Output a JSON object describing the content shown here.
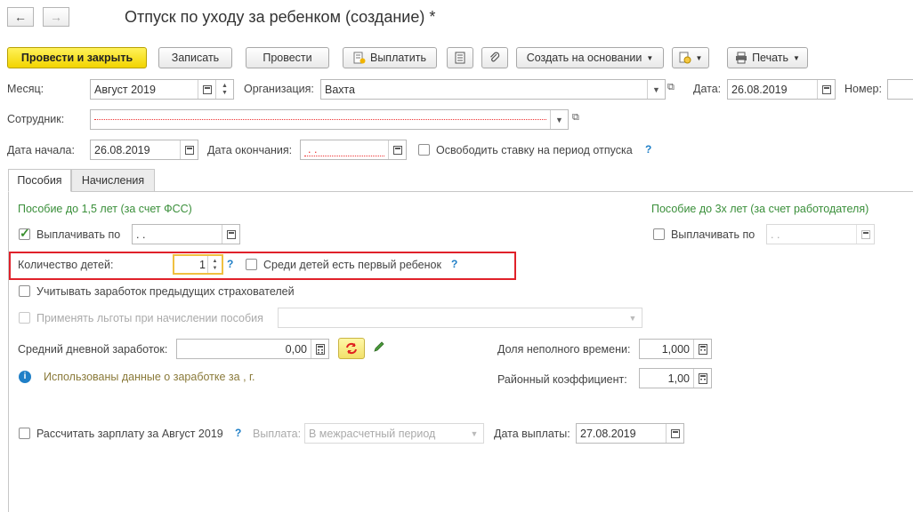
{
  "window": {
    "title": "Отпуск по уходу за ребенком (создание) *"
  },
  "nav": {
    "back_icon": "←",
    "forward_icon": "→"
  },
  "toolbar": {
    "post_close": "Провести и закрыть",
    "save": "Записать",
    "post": "Провести",
    "pay": "Выплатить",
    "create_based": "Создать на основании",
    "print": "Печать"
  },
  "row1": {
    "month_label": "Месяц:",
    "month_value": "Август 2019",
    "org_label": "Организация:",
    "org_value": "Вахта",
    "date_label": "Дата:",
    "date_value": "26.08.2019",
    "number_label": "Номер:"
  },
  "row2": {
    "employee_label": "Сотрудник:",
    "employee_value": ""
  },
  "row3": {
    "start_label": "Дата начала:",
    "start_value": "26.08.2019",
    "end_label": "Дата окончания:",
    "end_value": " .  .",
    "free_rate_label": "Освободить ставку на период отпуска"
  },
  "tabs": [
    {
      "label": "Пособия"
    },
    {
      "label": "Начисления"
    }
  ],
  "benefits": {
    "fss_heading": "Пособие до 1,5 лет (за счет ФСС)",
    "employer_heading": "Пособие до 3х лет (за счет работодателя)",
    "pay_until_label": "Выплачивать по",
    "pay_until_value": " .  .",
    "pay_until3_label": "Выплачивать по",
    "pay_until3_value": " .  .",
    "children_label": "Количество детей:",
    "children_value": "1",
    "first_child_label": "Среди детей есть первый ребенок",
    "prev_insurers_label": "Учитывать заработок предыдущих страхователей",
    "apply_benefits_label": "Применять льготы при начислении пособия",
    "avg_daily_label": "Средний дневной заработок:",
    "avg_daily_value": "0,00",
    "part_time_label": "Доля неполного времени:",
    "part_time_value": "1,000",
    "district_label": "Районный коэффициент:",
    "district_value": "1,00",
    "info_text": "Использованы данные о заработке за  ,   г.",
    "calc_salary_label": "Рассчитать зарплату за Август 2019",
    "payment_label": "Выплата:",
    "payment_value": "В межрасчетный период",
    "pay_date_label": "Дата выплаты:",
    "pay_date_value": "27.08.2019"
  },
  "help_mark": "?"
}
